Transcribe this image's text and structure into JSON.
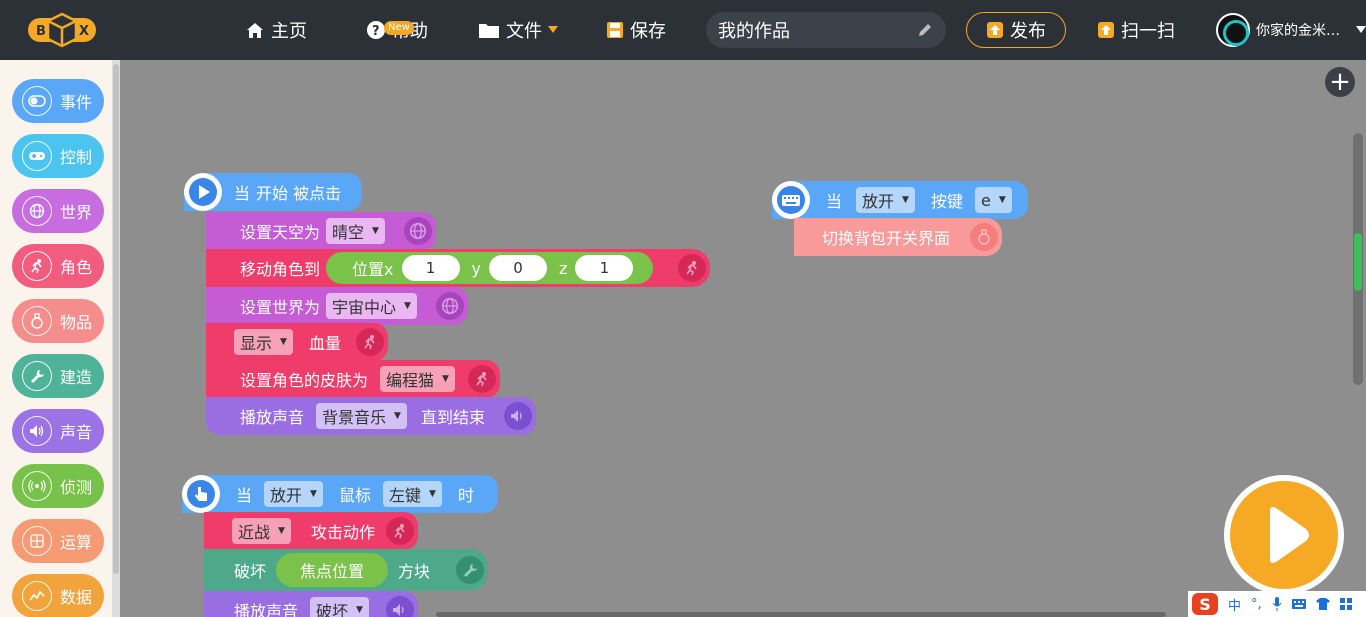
{
  "header": {
    "logo_text": "BOX",
    "nav": {
      "home": "主页",
      "help": "帮助",
      "help_badge": "New",
      "file": "文件",
      "save": "保存"
    },
    "project_title": "我的作品",
    "publish": "发布",
    "scan": "扫一扫",
    "user_name": "你家的金米…"
  },
  "sidebar": {
    "categories": [
      {
        "label": "事件",
        "color": "#5ba7f7"
      },
      {
        "label": "控制",
        "color": "#4cc4f0"
      },
      {
        "label": "世界",
        "color": "#c86de0"
      },
      {
        "label": "角色",
        "color": "#f25c7f"
      },
      {
        "label": "物品",
        "color": "#f58d8d"
      },
      {
        "label": "建造",
        "color": "#4fb39a"
      },
      {
        "label": "声音",
        "color": "#9c73e6"
      },
      {
        "label": "侦测",
        "color": "#77c24a"
      },
      {
        "label": "运算",
        "color": "#f59a73"
      },
      {
        "label": "数据",
        "color": "#f2a43c"
      }
    ]
  },
  "blocks": {
    "stack1": {
      "hat": {
        "prefix": "当",
        "text": "开始 被点击"
      },
      "sky": {
        "label": "设置天空为",
        "value": "晴空"
      },
      "move": {
        "label": "移动角色到",
        "pos_label": "位置x",
        "x": "1",
        "y_label": "y",
        "y": "0",
        "z_label": "z",
        "z": "1"
      },
      "world": {
        "label": "设置世界为",
        "value": "宇宙中心"
      },
      "show": {
        "value": "显示",
        "label": "血量"
      },
      "skin": {
        "label": "设置角色的皮肤为",
        "value": "编程猫"
      },
      "sound": {
        "label": "播放声音",
        "value": "背景音乐",
        "suffix": "直到结束"
      }
    },
    "stack2": {
      "hat": {
        "prefix": "当",
        "action": "放开",
        "label": "鼠标",
        "button": "左键",
        "suffix": "时"
      },
      "attack": {
        "value": "近战",
        "label": "攻击动作"
      },
      "break": {
        "label": "破坏",
        "pill": "焦点位置",
        "suffix": "方块"
      },
      "sound": {
        "label": "播放声音",
        "value": "破坏"
      }
    },
    "stack3": {
      "hat": {
        "prefix": "当",
        "action": "放开",
        "label": "按键",
        "key": "e"
      },
      "toggle": {
        "label": "切换背包开关界面"
      }
    }
  },
  "ime": {
    "lang": "中"
  },
  "colors": {
    "event": "#5ba7f7",
    "world": "#c65bd6",
    "role": "#f03c6b",
    "build": "#4ea88a",
    "sound": "#9a6de3",
    "detect": "#7ac24a",
    "item": "#f89a9a",
    "accent": "#f6a924"
  }
}
